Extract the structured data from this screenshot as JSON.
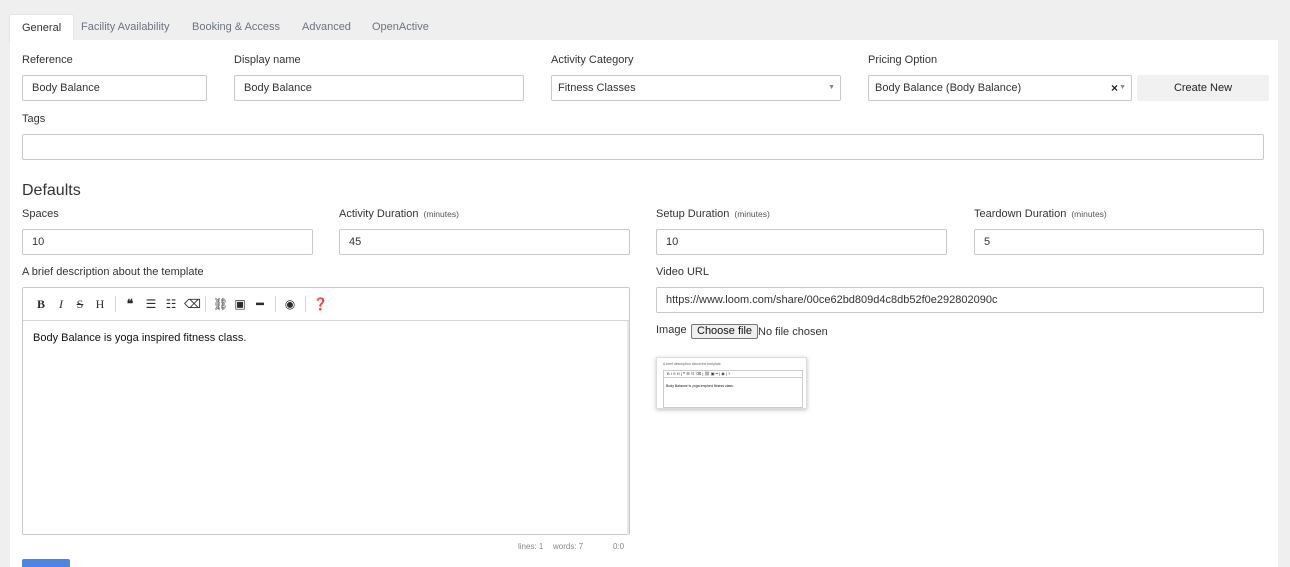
{
  "tabs": [
    {
      "label": "General"
    },
    {
      "label": "Facility Availability"
    },
    {
      "label": "Booking & Access"
    },
    {
      "label": "Advanced"
    },
    {
      "label": "OpenActive"
    }
  ],
  "general": {
    "reference": {
      "label": "Reference",
      "value": "Body Balance"
    },
    "display_name": {
      "label": "Display name",
      "value": "Body Balance"
    },
    "activity_category": {
      "label": "Activity Category",
      "value": "Fitness Classes"
    },
    "pricing_option": {
      "label": "Pricing Option",
      "value": "Body Balance (Body Balance)",
      "clear_glyph": "×"
    },
    "create_new_label": "Create New",
    "tags": {
      "label": "Tags",
      "value": ""
    }
  },
  "defaults": {
    "title": "Defaults",
    "spaces": {
      "label": "Spaces",
      "value": "10"
    },
    "activity_duration": {
      "label": "Activity Duration",
      "unit": "(minutes)",
      "value": "45"
    },
    "setup_duration": {
      "label": "Setup Duration",
      "unit": "(minutes)",
      "value": "10"
    },
    "teardown_duration": {
      "label": "Teardown Duration",
      "unit": "(minutes)",
      "value": "5"
    }
  },
  "description": {
    "label": "A brief description about the template",
    "text": "Body Balance is yoga inspired fitness class.",
    "toolbar": [
      "bold-icon",
      "italic-icon",
      "strikethrough-icon",
      "heading-icon",
      "quote-icon",
      "bullet-list-icon",
      "numbered-list-icon",
      "eraser-icon",
      "link-icon",
      "image-icon",
      "horizontal-rule-icon",
      "preview-icon",
      "help-icon"
    ],
    "status": {
      "lines": "lines: 1",
      "words": "words: 7",
      "cursor": "0:0"
    }
  },
  "video": {
    "label": "Video URL",
    "value": "https://www.loom.com/share/00ce62bd809d4c8db52f0e292802090c"
  },
  "image": {
    "label": "Image",
    "button_label": "Choose file",
    "status": "No file chosen",
    "thumbnail": {
      "caption": "A brief description about the template",
      "text": "Body Balance is yoga inspired fitness class."
    }
  },
  "colors": {
    "accent": "#4a86e8",
    "background": "#efefef",
    "panel": "#ffffff"
  }
}
